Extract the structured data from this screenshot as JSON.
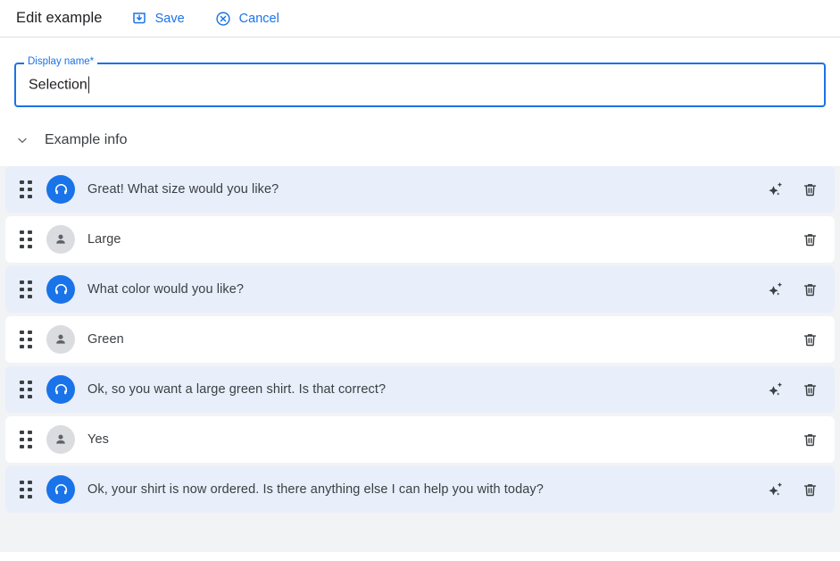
{
  "header": {
    "title": "Edit example",
    "save_label": "Save",
    "save_icon": "save-icon",
    "cancel_label": "Cancel",
    "cancel_icon": "cancel-circle-icon"
  },
  "form": {
    "display_name": {
      "label": "Display name*",
      "value": "Selection",
      "placeholder": ""
    }
  },
  "section": {
    "title": "Example info",
    "expanded": true,
    "chevron_icon": "chevron-down-icon"
  },
  "colors": {
    "accent": "#1a73e8",
    "agent_row_bg": "#e8eefa",
    "user_row_bg": "#ffffff",
    "page_bg": "#f1f3f4",
    "text": "#3c4043"
  },
  "conversation": {
    "row_icons": {
      "drag": "drag-handle-icon",
      "agent_avatar": "headset-icon",
      "user_avatar": "person-icon",
      "sparkle": "sparkle-icon",
      "delete": "trash-icon"
    },
    "rows": [
      {
        "speaker": "agent",
        "text": "Great! What size would you like?",
        "has_sparkle": true
      },
      {
        "speaker": "user",
        "text": "Large",
        "has_sparkle": false
      },
      {
        "speaker": "agent",
        "text": "What color would you like?",
        "has_sparkle": true
      },
      {
        "speaker": "user",
        "text": "Green",
        "has_sparkle": false
      },
      {
        "speaker": "agent",
        "text": "Ok, so you want a large green shirt. Is that correct?",
        "has_sparkle": true
      },
      {
        "speaker": "user",
        "text": "Yes",
        "has_sparkle": false
      },
      {
        "speaker": "agent",
        "text": "Ok, your shirt is now ordered. Is there anything else I can help you with today?",
        "has_sparkle": true
      }
    ]
  }
}
